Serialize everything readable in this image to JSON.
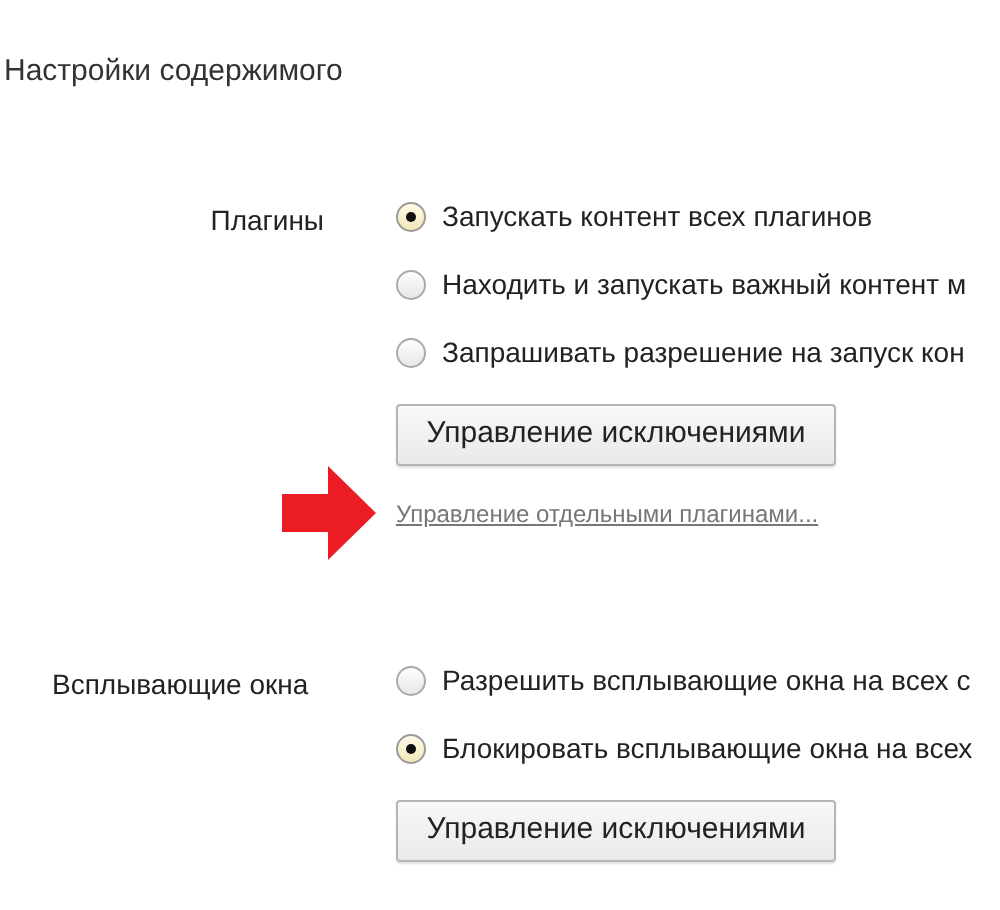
{
  "title": "Настройки содержимого",
  "sections": [
    {
      "label": "Плагины",
      "options": [
        {
          "label": "Запускать контент всех плагинов",
          "selected": true
        },
        {
          "label": "Находить и запускать важный контент м",
          "selected": false
        },
        {
          "label": "Запрашивать разрешение на запуск кон",
          "selected": false
        }
      ],
      "button": "Управление исключениями",
      "link": "Управление отдельными плагинами..."
    },
    {
      "label": "Всплывающие окна",
      "options": [
        {
          "label": "Разрешить всплывающие окна на всех с",
          "selected": false
        },
        {
          "label": "Блокировать всплывающие окна на всех",
          "selected": true
        }
      ],
      "button": "Управление исключениями"
    }
  ]
}
